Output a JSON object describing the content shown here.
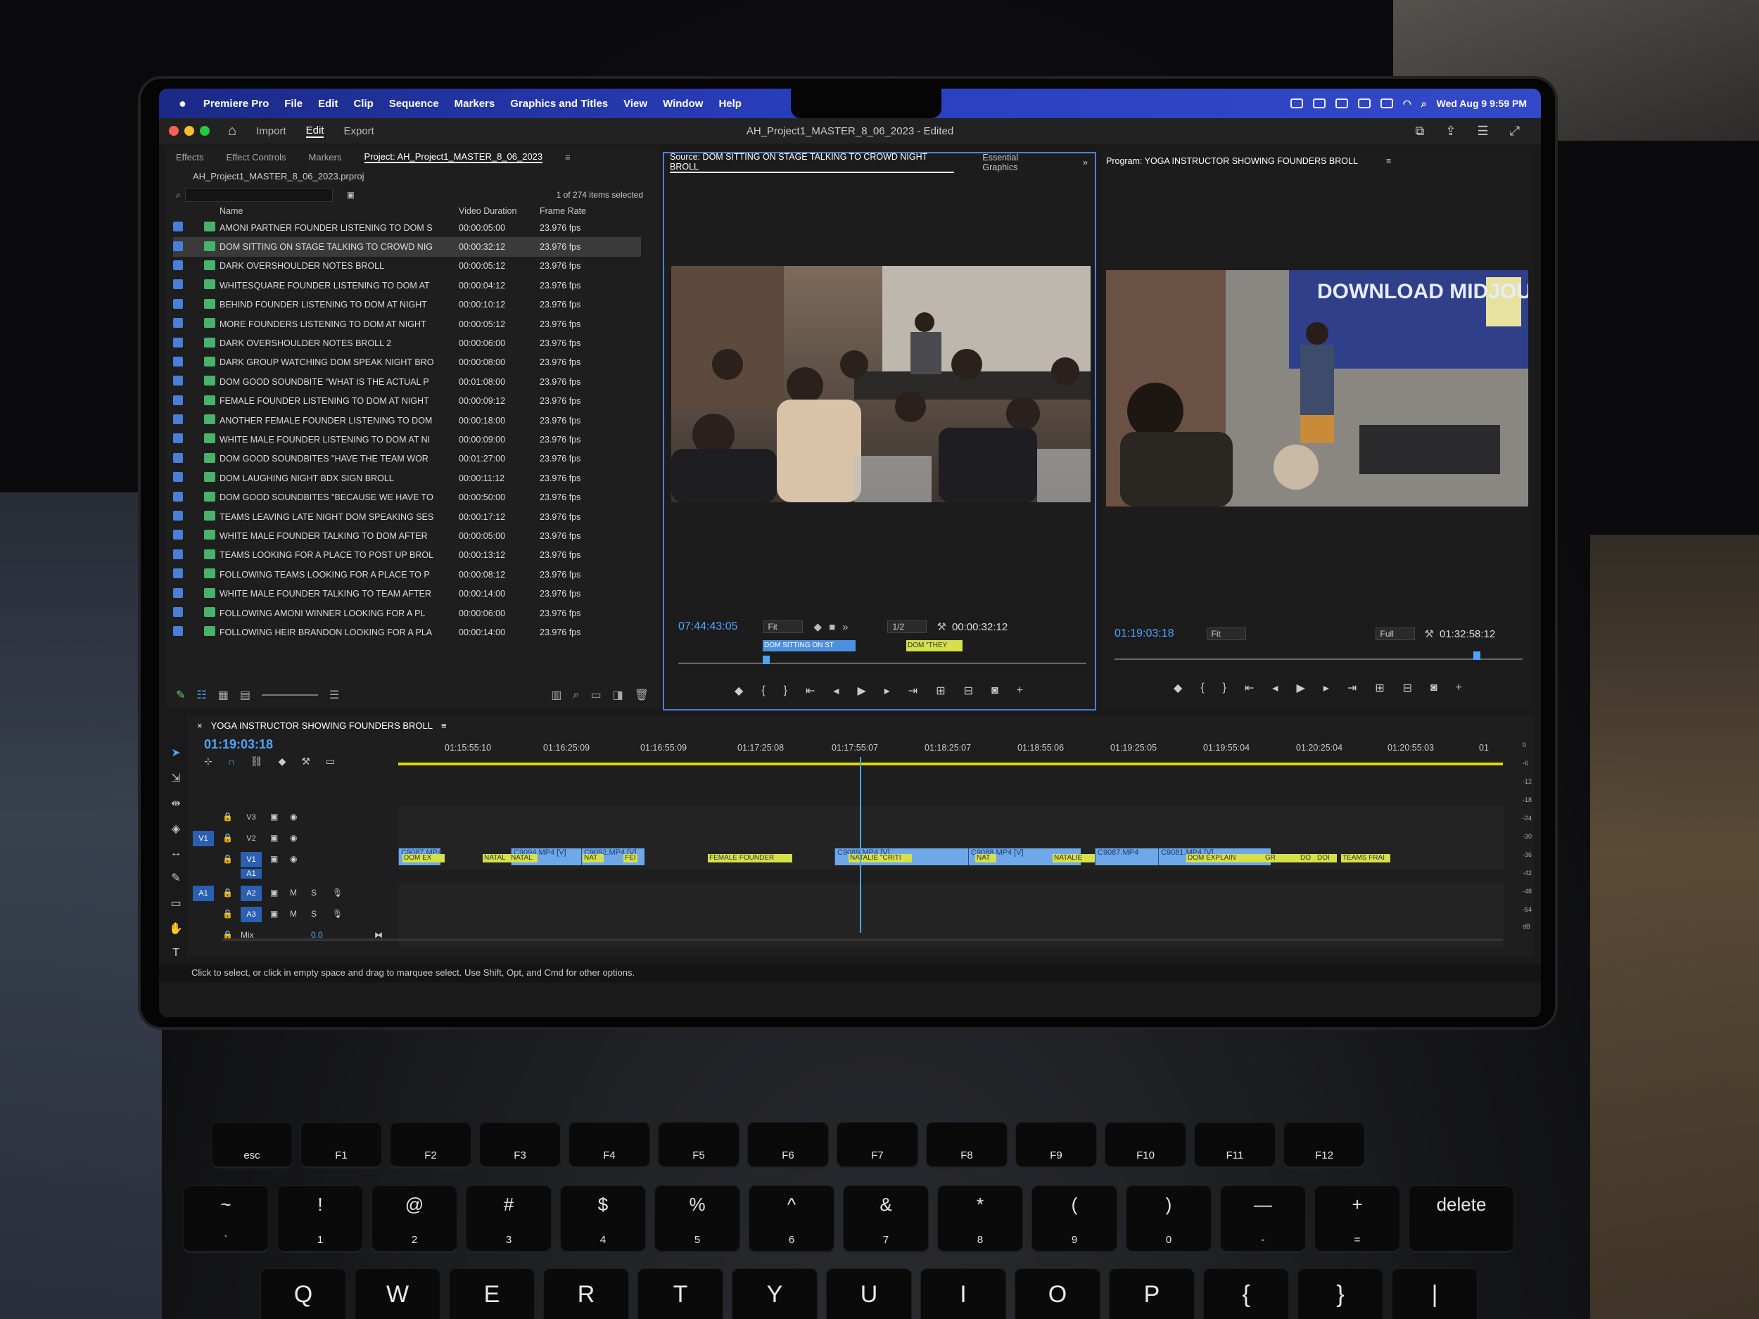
{
  "menubar": {
    "app_name": "Premiere Pro",
    "items": [
      "File",
      "Edit",
      "Clip",
      "Sequence",
      "Markers",
      "Graphics and Titles",
      "View",
      "Window",
      "Help"
    ],
    "clock": "Wed Aug 9  9:59 PM"
  },
  "titlebar": {
    "workspaces": [
      "Import",
      "Edit",
      "Export"
    ],
    "active_workspace": "Edit",
    "window_title": "AH_Project1_MASTER_8_06_2023 - Edited"
  },
  "project_panel": {
    "tabs": [
      "Effects",
      "Effect Controls",
      "Markers",
      "Project: AH_Project1_MASTER_8_06_2023"
    ],
    "file_name": "AH_Project1_MASTER_8_06_2023.prproj",
    "selection_info": "1 of 274 items selected",
    "columns": [
      "Name",
      "Video Duration",
      "Frame Rate"
    ],
    "rows": [
      {
        "name": "AMONI PARTNER FOUNDER LISTENING TO DOM S",
        "duration": "00:00:05:00",
        "fps": "23.976 fps"
      },
      {
        "name": "DOM SITTING ON STAGE TALKING TO CROWD NIG",
        "duration": "00:00:32:12",
        "fps": "23.976 fps",
        "selected": true
      },
      {
        "name": "DARK OVERSHOULDER NOTES BROLL",
        "duration": "00:00:05:12",
        "fps": "23.976 fps"
      },
      {
        "name": "WHITESQUARE FOUNDER LISTENING TO DOM AT",
        "duration": "00:00:04:12",
        "fps": "23.976 fps"
      },
      {
        "name": "BEHIND FOUNDER LISTENING TO DOM AT NIGHT",
        "duration": "00:00:10:12",
        "fps": "23.976 fps"
      },
      {
        "name": "MORE FOUNDERS LISTENING TO DOM AT NIGHT",
        "duration": "00:00:05:12",
        "fps": "23.976 fps"
      },
      {
        "name": "DARK OVERSHOULDER NOTES BROLL 2",
        "duration": "00:00:06:00",
        "fps": "23.976 fps"
      },
      {
        "name": "DARK GROUP WATCHING DOM SPEAK NIGHT BRO",
        "duration": "00:00:08:00",
        "fps": "23.976 fps"
      },
      {
        "name": "DOM GOOD SOUNDBITE \"WHAT IS THE ACTUAL P",
        "duration": "00:01:08:00",
        "fps": "23.976 fps"
      },
      {
        "name": "FEMALE FOUNDER LISTENING TO DOM AT NIGHT",
        "duration": "00:00:09:12",
        "fps": "23.976 fps"
      },
      {
        "name": "ANOTHER FEMALE FOUNDER LISTENING TO DOM",
        "duration": "00:00:18:00",
        "fps": "23.976 fps"
      },
      {
        "name": "WHITE MALE FOUNDER LISTENING TO DOM AT NI",
        "duration": "00:00:09:00",
        "fps": "23.976 fps"
      },
      {
        "name": "DOM GOOD SOUNDBITES \"HAVE THE TEAM WOR",
        "duration": "00:01:27:00",
        "fps": "23.976 fps"
      },
      {
        "name": "DOM LAUGHING NIGHT BDX SIGN BROLL",
        "duration": "00:00:11:12",
        "fps": "23.976 fps"
      },
      {
        "name": "DOM GOOD SOUNDBITES \"BECAUSE WE HAVE TO",
        "duration": "00:00:50:00",
        "fps": "23.976 fps"
      },
      {
        "name": "TEAMS LEAVING LATE NIGHT DOM SPEAKING SES",
        "duration": "00:00:17:12",
        "fps": "23.976 fps"
      },
      {
        "name": "WHITE MALE FOUNDER TALKING TO DOM AFTER",
        "duration": "00:00:05:00",
        "fps": "23.976 fps"
      },
      {
        "name": "TEAMS LOOKING FOR A PLACE TO POST UP BROL",
        "duration": "00:00:13:12",
        "fps": "23.976 fps"
      },
      {
        "name": "FOLLOWING TEAMS LOOKING FOR A PLACE TO P",
        "duration": "00:00:08:12",
        "fps": "23.976 fps"
      },
      {
        "name": "WHITE MALE FOUNDER TALKING TO TEAM AFTER",
        "duration": "00:00:14:00",
        "fps": "23.976 fps"
      },
      {
        "name": "FOLLOWING AMONI WINNER LOOKING FOR A PL",
        "duration": "00:00:06:00",
        "fps": "23.976 fps"
      },
      {
        "name": "FOLLOWING HEIR BRANDON LOOKING FOR A PLA",
        "duration": "00:00:14:00",
        "fps": "23.976 fps"
      }
    ]
  },
  "source_monitor": {
    "tab": "Source: DOM SITTING ON STAGE TALKING TO CROWD NIGHT BROLL",
    "tab2": "Essential Graphics",
    "timecode": "07:44:43:05",
    "fit": "Fit",
    "resolution": "1/2",
    "duration": "00:00:32:12",
    "marker1": "DOM SITTING ON ST",
    "marker2": "DOM \"THEY"
  },
  "program_monitor": {
    "tab": "Program: YOGA INSTRUCTOR SHOWING FOUNDERS BROLL",
    "timecode": "01:19:03:18",
    "fit": "Fit",
    "resolution": "Full",
    "duration": "01:32:58:12",
    "slide_text": "DOWNLOAD MIDJOURNEY"
  },
  "timeline": {
    "sequence_name": "YOGA INSTRUCTOR SHOWING FOUNDERS BROLL",
    "timecode": "01:19:03:18",
    "ruler": [
      "01:15:55:10",
      "01:16:25:09",
      "01:16:55:09",
      "01:17:25:08",
      "01:17:55:07",
      "01:18:25:07",
      "01:18:55:06",
      "01:19:25:05",
      "01:19:55:04",
      "01:20:25:04",
      "01:20:55:03",
      "01"
    ],
    "tracks": [
      "V3",
      "V2",
      "V1",
      "A1",
      "A2",
      "A3"
    ],
    "src_v": "V1",
    "src_a": "A1",
    "mix_label": "Mix",
    "mix_value": "0.0",
    "clip_labels": [
      "C9087.MP4 [V]",
      "DOM EX",
      "NATAL",
      "C9094.MP4 [V]",
      "NATAL",
      "C9092.MP4 [V]",
      "NAT",
      "FEI",
      "FEMALE FOUNDER",
      "C9089.MP4 [V]",
      "NATALIE \"CRITI",
      "C9088.MP4 [V]",
      "NAT",
      "NATALIE",
      "C9087.MP4",
      "C9081.MP4 [V]",
      "DOM EXPLAIN",
      "GR",
      "DO",
      "DOI",
      "TEAMS FRAI"
    ]
  },
  "meter_labels": [
    "0",
    "-6",
    "-12",
    "-18",
    "-24",
    "-30",
    "-36",
    "-42",
    "-48",
    "-54",
    "dB"
  ],
  "status_bar": "Click to select, or click in empty space and drag to marquee select. Use Shift, Opt, and Cmd for other options.",
  "keyboard": {
    "fn_row": [
      {
        "label": "esc"
      },
      {
        "label": "F1"
      },
      {
        "label": "F2"
      },
      {
        "label": "F3"
      },
      {
        "label": "F4"
      },
      {
        "label": "F5"
      },
      {
        "label": "F6"
      },
      {
        "label": "F7"
      },
      {
        "label": "F8"
      },
      {
        "label": "F9"
      },
      {
        "label": "F10"
      },
      {
        "label": "F11"
      },
      {
        "label": "F12"
      }
    ],
    "num_row": [
      {
        "top": "~",
        "bottom": "`"
      },
      {
        "top": "!",
        "bottom": "1"
      },
      {
        "top": "@",
        "bottom": "2"
      },
      {
        "top": "#",
        "bottom": "3"
      },
      {
        "top": "$",
        "bottom": "4"
      },
      {
        "top": "%",
        "bottom": "5"
      },
      {
        "top": "^",
        "bottom": "6"
      },
      {
        "top": "&",
        "bottom": "7"
      },
      {
        "top": "*",
        "bottom": "8"
      },
      {
        "top": "(",
        "bottom": "9"
      },
      {
        "top": ")",
        "bottom": "0"
      },
      {
        "top": "—",
        "bottom": "-"
      },
      {
        "top": "+",
        "bottom": "="
      },
      {
        "top": "delete",
        "bottom": ""
      }
    ],
    "letter_row": [
      "Q",
      "W",
      "E",
      "R",
      "T",
      "Y",
      "U",
      "I",
      "O",
      "P",
      "{",
      "}",
      "|"
    ]
  }
}
